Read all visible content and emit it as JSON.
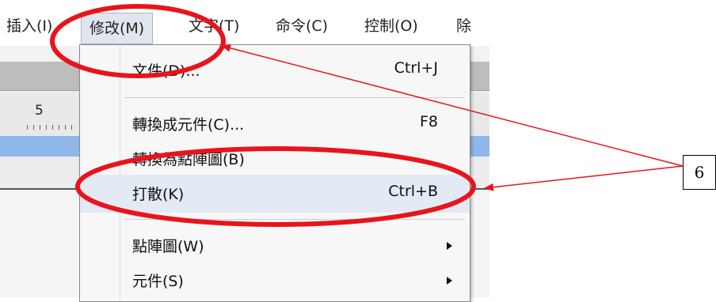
{
  "menubar": {
    "items": [
      "插入(I)",
      "修改(M)",
      "文字(T)",
      "命令(C)",
      "控制(O)",
      "除"
    ],
    "active_index": 1
  },
  "ruler": {
    "tick_label": "5"
  },
  "dropdown": {
    "items": [
      {
        "label": "文件(D)...",
        "shortcut": "Ctrl+J",
        "submenu": false
      },
      {
        "label": "轉換成元件(C)...",
        "shortcut": "F8",
        "submenu": false
      },
      {
        "label": "轉換為點陣圖(B)",
        "shortcut": "",
        "submenu": false
      },
      {
        "label": "打散(K)",
        "shortcut": "Ctrl+B",
        "submenu": false,
        "highlighted": true
      },
      {
        "label": "點陣圖(W)",
        "shortcut": "",
        "submenu": true
      },
      {
        "label": "元件(S)",
        "shortcut": "",
        "submenu": true
      }
    ]
  },
  "annotation": {
    "callout_label": "6",
    "color": "#e8141c"
  }
}
